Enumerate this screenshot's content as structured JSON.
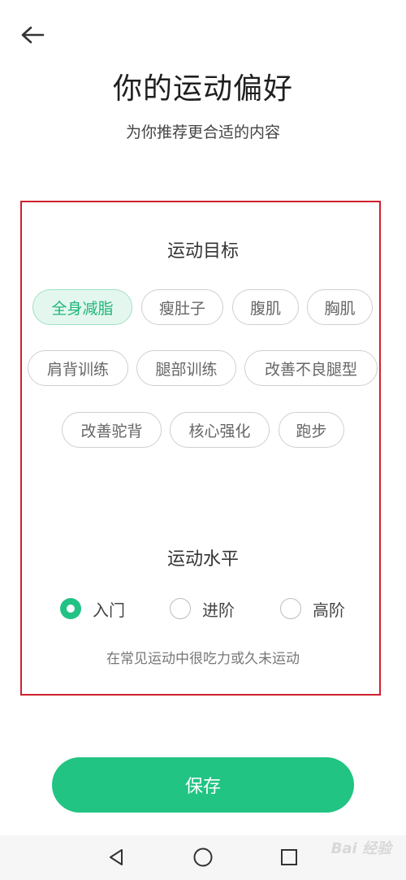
{
  "header": {
    "title": "你的运动偏好",
    "subtitle": "为你推荐更合适的内容"
  },
  "goals": {
    "title": "运动目标",
    "chips": [
      {
        "label": "全身减脂",
        "selected": true
      },
      {
        "label": "瘦肚子",
        "selected": false
      },
      {
        "label": "腹肌",
        "selected": false
      },
      {
        "label": "胸肌",
        "selected": false
      },
      {
        "label": "肩背训练",
        "selected": false
      },
      {
        "label": "腿部训练",
        "selected": false
      },
      {
        "label": "改善不良腿型",
        "selected": false
      },
      {
        "label": "改善驼背",
        "selected": false
      },
      {
        "label": "核心强化",
        "selected": false
      },
      {
        "label": "跑步",
        "selected": false
      }
    ]
  },
  "level": {
    "title": "运动水平",
    "options": [
      {
        "label": "入门",
        "checked": true
      },
      {
        "label": "进阶",
        "checked": false
      },
      {
        "label": "高阶",
        "checked": false
      }
    ],
    "description": "在常见运动中很吃力或久未运动"
  },
  "save_label": "保存",
  "watermark": "Bai 经验",
  "colors": {
    "accent": "#21c483",
    "selected_chip_bg": "#e4f7ee",
    "highlight_border": "#d0202e"
  },
  "icons": {
    "back": "back-arrow-icon",
    "nav_back": "triangle-back-icon",
    "nav_home": "circle-home-icon",
    "nav_recent": "square-recent-icon"
  }
}
